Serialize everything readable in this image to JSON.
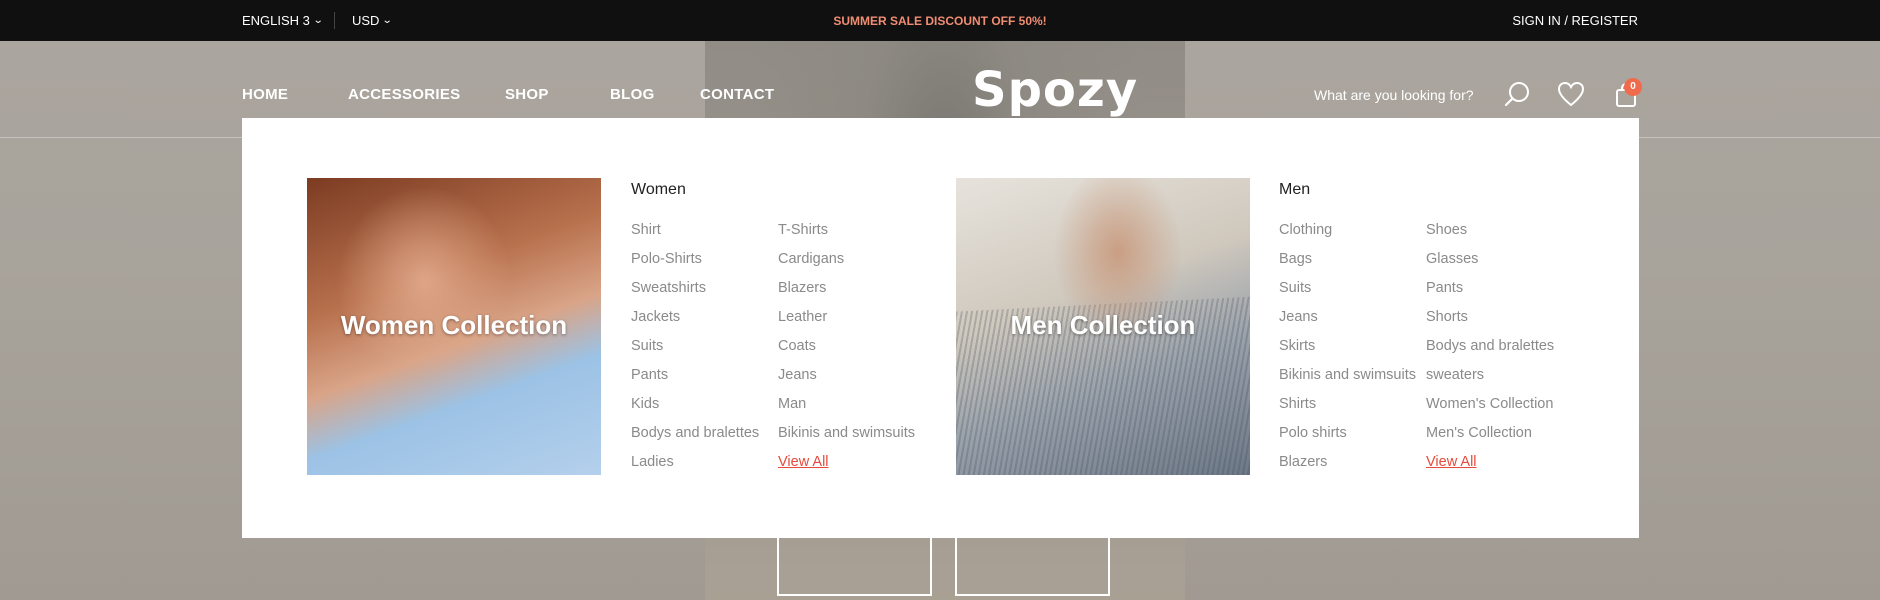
{
  "topbar": {
    "language": "ENGLISH 3",
    "currency": "USD",
    "promo": "SUMMER SALE DISCOUNT OFF 50%!",
    "auth": "SIGN IN / REGISTER"
  },
  "nav": {
    "items": [
      "HOME",
      "ACCESSORIES",
      "SHOP",
      "BLOG",
      "CONTACT"
    ],
    "logo": "Spozy",
    "search_placeholder": "What are you looking for?",
    "cart_count": "0"
  },
  "mega_menu": {
    "women": {
      "image_title": "Women Collection",
      "heading": "Women",
      "col1": [
        "Shirt",
        "Polo-Shirts",
        "Sweatshirts",
        "Jackets",
        "Suits",
        "Pants",
        "Kids",
        "Bodys and bralettes",
        "Ladies"
      ],
      "col2": [
        "T-Shirts",
        "Cardigans",
        "Blazers",
        "Leather",
        "Coats",
        "Jeans",
        "Man",
        "Bikinis and swimsuits",
        "View All"
      ]
    },
    "men": {
      "image_title": "Men Collection",
      "heading": "Men",
      "col1": [
        "Clothing",
        "Bags",
        "Suits",
        "Jeans",
        "Skirts",
        "Bikinis and swimsuits",
        "Shirts",
        "Polo shirts",
        "Blazers"
      ],
      "col2": [
        "Shoes",
        "Glasses",
        "Pants",
        "Shorts",
        "Bodys and bralettes",
        "sweaters",
        "Women's Collection",
        "Men's Collection",
        "View All"
      ]
    }
  },
  "icons": {
    "search": "search-icon",
    "wishlist": "heart-icon",
    "cart": "shopping-bag-icon",
    "chevron": "chevron-down-icon"
  },
  "colors": {
    "topbar_bg": "#101010",
    "promo": "#f08d73",
    "badge": "#f06a4c",
    "view_all": "#e64a3b"
  }
}
